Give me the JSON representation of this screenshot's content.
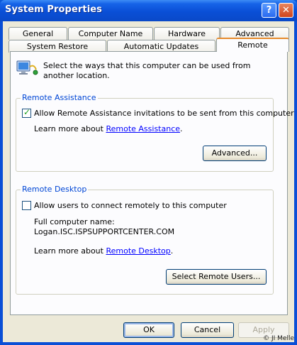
{
  "window": {
    "title": "System Properties",
    "help_symbol": "?",
    "close_symbol": "✕"
  },
  "tabs_row1": [
    "General",
    "Computer Name",
    "Hardware",
    "Advanced"
  ],
  "tabs_row2": [
    "System Restore",
    "Automatic Updates",
    "Remote"
  ],
  "active_tab": "Remote",
  "intro": {
    "text": "Select the ways that this computer can be used from another location.",
    "icon": "computer-network-icon"
  },
  "remote_assistance": {
    "group_title": "Remote Assistance",
    "checkbox_label": "Allow Remote Assistance invitations to be sent from this computer",
    "checked": true,
    "learn_prefix": "Learn more about ",
    "learn_link": "Remote Assistance",
    "learn_suffix": ".",
    "advanced_button": "Advanced..."
  },
  "remote_desktop": {
    "group_title": "Remote Desktop",
    "checkbox_label": "Allow users to connect remotely to this computer",
    "checked": false,
    "computer_name_label": "Full computer name:",
    "computer_name": "Logan.ISC.ISPSUPPORTCENTER.COM",
    "learn_prefix": "Learn more about ",
    "learn_link": "Remote Desktop",
    "learn_suffix": ".",
    "select_users_button": "Select Remote Users..."
  },
  "footer": {
    "ok": "OK",
    "cancel": "Cancel",
    "apply": "Apply"
  },
  "copyright": "© JI Melle",
  "colors": {
    "title_bar": "#0a4fd6",
    "dialog_bg": "#ece9d8",
    "group_title": "#0046d5",
    "link": "#0000ff",
    "tab_highlight": "#e68b2c"
  }
}
